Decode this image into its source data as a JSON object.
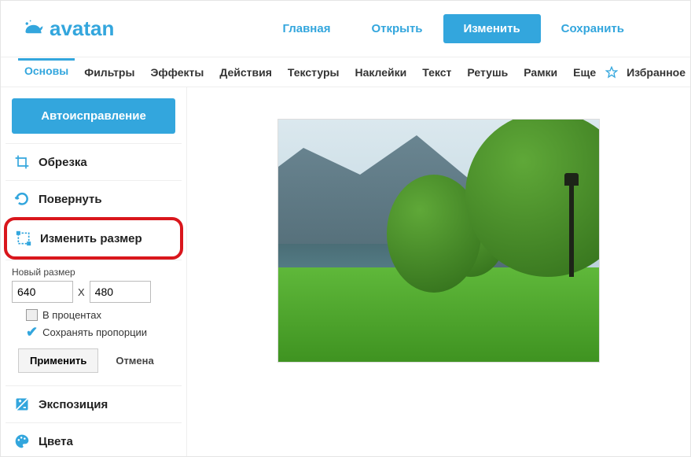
{
  "logo": "avatan",
  "topnav": {
    "home": "Главная",
    "open": "Открыть",
    "edit": "Изменить",
    "save": "Сохранить"
  },
  "tabs": [
    "Основы",
    "Фильтры",
    "Эффекты",
    "Действия",
    "Текстуры",
    "Наклейки",
    "Текст",
    "Ретушь",
    "Рамки",
    "Еще"
  ],
  "favorites": "Избранное",
  "sidebar": {
    "auto": "Автоисправление",
    "crop": "Обрезка",
    "rotate": "Повернуть",
    "resize": "Изменить размер",
    "exposure": "Экспозиция",
    "colors": "Цвета"
  },
  "resize": {
    "label": "Новый размер",
    "width": "640",
    "height": "480",
    "x": "X",
    "percent": "В процентах",
    "keep": "Сохранять пропорции",
    "apply": "Применить",
    "cancel": "Отмена"
  }
}
